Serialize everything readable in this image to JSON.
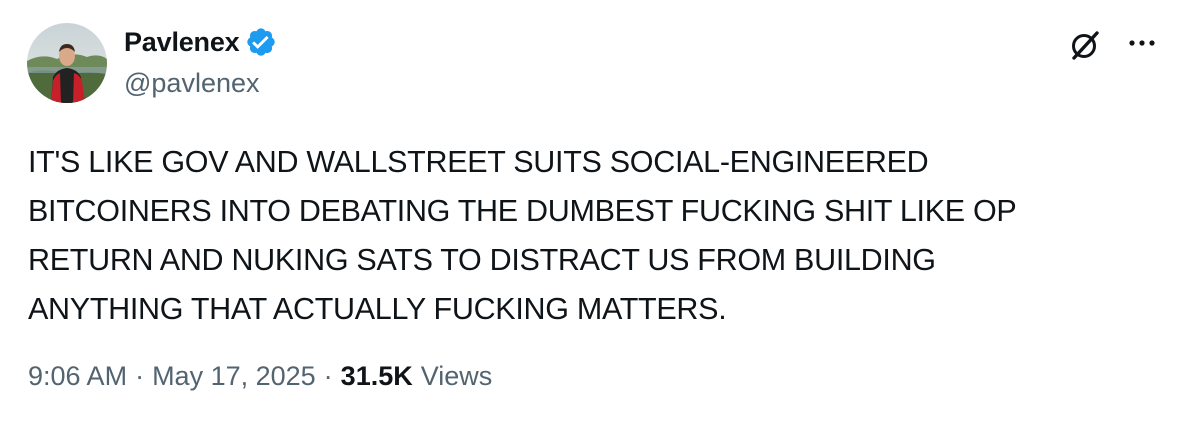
{
  "author": {
    "display_name": "Pavlenex",
    "handle": "@pavlenex",
    "verified": true,
    "verified_color": "#1d9bf0"
  },
  "tweet": {
    "text_lines": [
      "IT'S LIKE GOV AND WALLSTREET SUITS SOCIAL-ENGINEERED",
      "BITCOINERS INTO DEBATING THE DUMBEST FUCKING SHIT LIKE OP",
      "RETURN AND NUKING SATS TO DISTRACT US FROM BUILDING",
      "ANYTHING THAT ACTUALLY FUCKING MATTERS."
    ]
  },
  "meta": {
    "time": "9:06 AM",
    "separator": "·",
    "date": "May 17, 2025",
    "views_count": "31.5K",
    "views_label": "Views"
  },
  "icons": {
    "grok": "grok-icon",
    "more": "more-icon"
  },
  "colors": {
    "text": "#0f1419",
    "secondary": "#536471",
    "accent": "#1d9bf0"
  }
}
